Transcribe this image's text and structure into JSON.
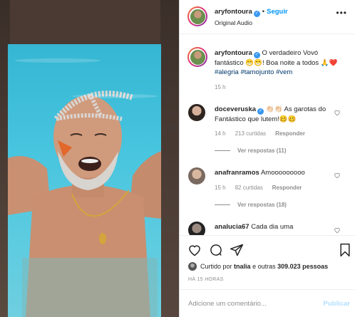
{
  "header": {
    "username": "aryfontoura",
    "follow_label": "Seguir",
    "dot": "•",
    "audio": "Original Audio",
    "more": "•••"
  },
  "caption": {
    "username": "aryfontoura",
    "text": "O verdadeiro Vovó fantástico 😁😁! Boa noite a todos 🙏❤️",
    "hashtags": "#alegria #tamojunto #vem",
    "time": "15 h"
  },
  "comments": [
    {
      "username": "doceveruska",
      "text": "👏🏻👏🏻 As garotas do Fantástico que lutem!🥴🥴",
      "time": "14 h",
      "likes": "213 curtidas",
      "reply": "Responder",
      "view_replies": "Ver respostas (11)"
    },
    {
      "username": "anafranramos",
      "text": "Amooooooooo",
      "time": "15 h",
      "likes": "82 curtidas",
      "reply": "Responder",
      "view_replies": "Ver respostas (18)"
    },
    {
      "username": "analucia67",
      "text": "Cada dia uma"
    }
  ],
  "actions": {
    "liked_by": "Curtido por",
    "liked_user": "tnalia",
    "liked_rest": "e outras",
    "liked_count": "309.023 pessoas",
    "time_ago": "HÁ 15 HORAS"
  },
  "add_comment": {
    "placeholder": "Adicione um comentário...",
    "post_label": "Publicar"
  },
  "colors": {
    "accent": "#0095f6",
    "verified": "#3897f0",
    "pool": "#48c5df",
    "hashtag": "#00376b"
  }
}
